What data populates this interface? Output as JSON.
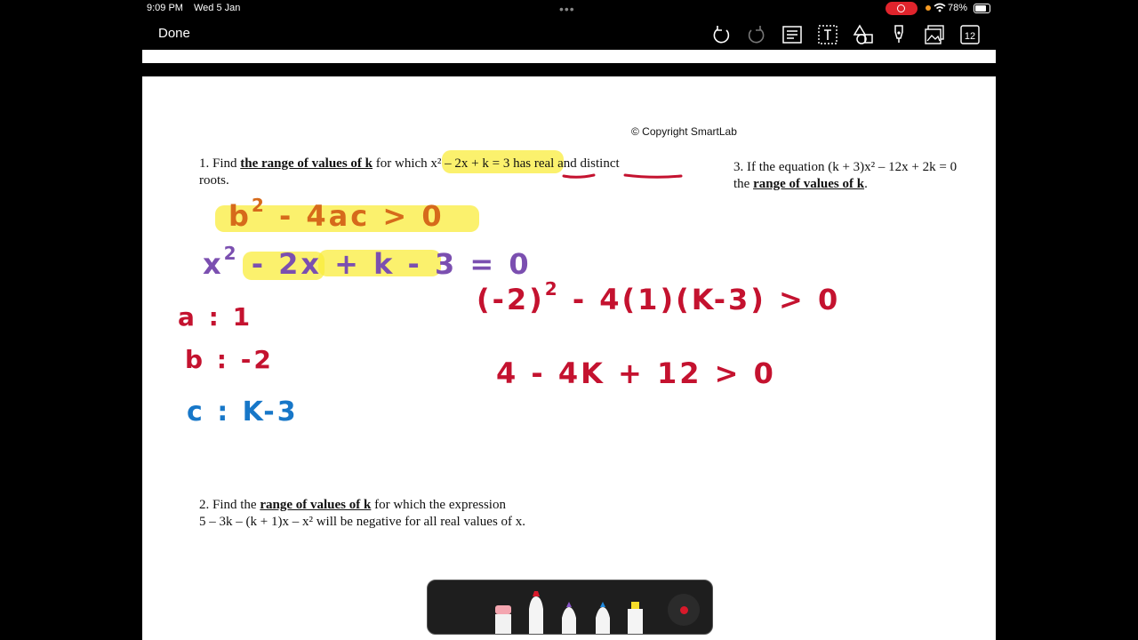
{
  "status_bar": {
    "time": "9:09 PM",
    "date": "Wed 5 Jan",
    "battery": "78%"
  },
  "toolbar": {
    "done_label": "Done",
    "page_count": "12",
    "icons": [
      "undo-icon",
      "redo-icon",
      "document-list-icon",
      "text-box-icon",
      "shapes-icon",
      "pen-icon",
      "image-icon",
      "page-count-icon"
    ]
  },
  "document": {
    "copyright": "© Copyright SmartLab",
    "q1": {
      "prefix": "1. Find ",
      "bold": "the range of values of k",
      "middle": " for which x² – 2x + k = 3 has ",
      "real": "real",
      "and": " and ",
      "distinct": "distinct",
      "line2": "roots."
    },
    "q2": {
      "prefix": "2. Find the ",
      "bold": "range of values of k",
      "middle": " for which the expression",
      "line2": "5 – 3k – (k + 1)x – x² will be negative for all real values of x."
    },
    "q3": {
      "line1": "3. If the equation (k + 3)x² – 12x + 2k = 0",
      "prefix2": "the ",
      "bold": "range of values of k",
      "suffix2": "."
    }
  },
  "handwriting": {
    "discriminant": "b",
    "discriminant_sup": "2",
    "discriminant_rest": " - 4ac > 0",
    "equation_a": "x",
    "equation_sup": "2",
    "equation_b": " - 2x + k - 3 = 0",
    "coef_a": "a : 1",
    "coef_b": "b : -2",
    "coef_c": "c : K-3",
    "sub_a": "(-2)",
    "sub_sup": "2",
    "sub_b": " - 4(1)(K-3) > 0",
    "simplified": "4 - 4K + 12 > 0"
  },
  "colors": {
    "red_ink": "#c4122f",
    "blue_ink": "#1777c8",
    "purple_ink": "#7b4fb0",
    "highlight": "#faec3c",
    "record": "#e0242c"
  },
  "pen_tray": {
    "tools": [
      "eraser-tool",
      "red-marker-tool",
      "purple-pen-tool",
      "blue-pen-tool",
      "yellow-highlighter-tool"
    ]
  }
}
